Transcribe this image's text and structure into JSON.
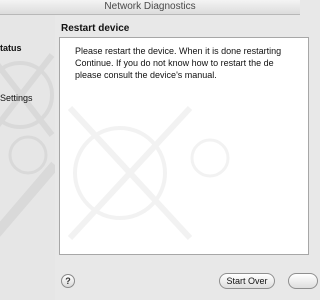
{
  "window": {
    "title": "Network Diagnostics"
  },
  "sidebar": {
    "items": [
      {
        "label": "tatus"
      },
      {
        "label": "Settings"
      }
    ]
  },
  "main": {
    "title": "Restart device",
    "message_lines": [
      "Please restart the device. When it is done restarting",
      "Continue. If you do not know how to restart the de",
      "please consult the device's manual."
    ]
  },
  "footer": {
    "help_label": "?",
    "start_over_label": "Start Over",
    "next_label": ""
  },
  "colors": {
    "background": "#e8e8e8",
    "panel": "#ffffff"
  }
}
